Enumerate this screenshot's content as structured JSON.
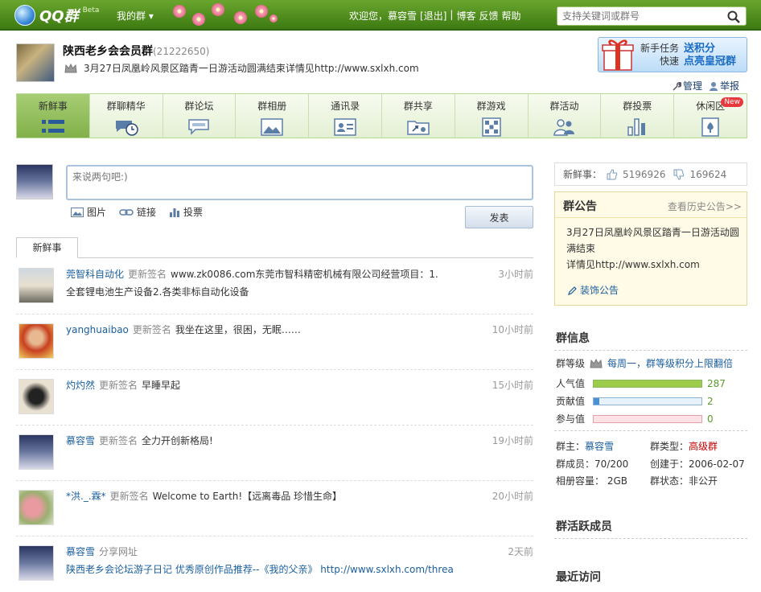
{
  "topbar": {
    "logo": "QQ群",
    "beta": "Beta",
    "my_group": "我的群 ▾",
    "welcome": "欢迎您，慕容雪",
    "logout": "[退出]",
    "sep": "|",
    "links": [
      "博客",
      "反馈",
      "帮助"
    ],
    "search_placeholder": "支持关键词或群号"
  },
  "group": {
    "name": "陕西老乡会会员群",
    "id": "(21222650)",
    "signature": "3月27日凤凰岭风景区踏青一日游活动圆满结束详情见http://www.sxlxh.com",
    "admin": "管理",
    "report": "举报"
  },
  "promo": {
    "line1a": "新手任务",
    "line1b": "送积分",
    "line2a": "快速",
    "line2b": "点亮皇冠群"
  },
  "tabs": [
    {
      "label": "新鲜事",
      "icon": "fresh-news-icon"
    },
    {
      "label": "群聊精华",
      "icon": "chat-digest-icon"
    },
    {
      "label": "群论坛",
      "icon": "forum-icon"
    },
    {
      "label": "群相册",
      "icon": "album-icon"
    },
    {
      "label": "通讯录",
      "icon": "contacts-icon"
    },
    {
      "label": "群共享",
      "icon": "share-folder-icon"
    },
    {
      "label": "群游戏",
      "icon": "game-icon"
    },
    {
      "label": "群活动",
      "icon": "activity-icon"
    },
    {
      "label": "群投票",
      "icon": "vote-icon"
    },
    {
      "label": "休闲区",
      "icon": "leisure-icon",
      "badge": "New"
    }
  ],
  "post": {
    "placeholder": "来说两句吧:)",
    "tool_image": "图片",
    "tool_link": "链接",
    "tool_vote": "投票",
    "submit": "发表"
  },
  "feed_tab": "新鲜事",
  "feed": [
    {
      "user": "莞智科自动化",
      "action": "更新签名",
      "text": "www.zk0086.com东莞市智科精密机械有限公司经营项目：1.",
      "line2": "全套锂电池生产设备2.各类非标自动化设备",
      "time": "3小时前"
    },
    {
      "user": "yanghuaibao",
      "action": "更新签名",
      "text": "我坐在这里，很困，无眠……",
      "line2": "",
      "time": "10小时前"
    },
    {
      "user": "灼灼然",
      "action": "更新签名",
      "text": "早睡早起",
      "line2": "",
      "time": "15小时前"
    },
    {
      "user": "慕容雪",
      "action": "更新签名",
      "text": "全力开创新格局!",
      "line2": "",
      "time": "19小时前"
    },
    {
      "user": "*洪._.霖*",
      "action": "更新签名",
      "text": "Welcome to Earth!【远离毒品 珍惜生命】",
      "line2": "",
      "time": "20小时前"
    },
    {
      "user": "慕容雪",
      "action": "分享网址",
      "text": "",
      "line2": "陕西老乡会论坛游子日记 优秀原创作品推荐--《我的父亲》  http://www.sxlxh.com/threa",
      "time": "2天前"
    }
  ],
  "stats": {
    "label": "新鲜事：",
    "likes": "5196926",
    "dislikes": "169624"
  },
  "notice": {
    "title": "群公告",
    "history": "查看历史公告>>",
    "body1": "3月27日凤凰岭风景区踏青一日游活动圆满结束",
    "body2": "详情见http://www.sxlxh.com",
    "edit": "装饰公告"
  },
  "info": {
    "title": "群信息",
    "level_label": "群等级",
    "level_link": "每周一，群等级积分上限翻倍",
    "popularity_label": "人气值",
    "popularity": "287",
    "popularity_fraction": 1.0,
    "contribution_label": "贡献值",
    "contribution": "2",
    "contribution_fraction": 0.05,
    "participation_label": "参与值",
    "participation": "0",
    "participation_fraction": 0,
    "owner_label": "群主：",
    "owner": "慕容雪",
    "type_label": "群类型：",
    "type": "高级群",
    "members": "群成员：70/200",
    "created": "创建于：2006-02-07",
    "album": "相册容量：  2GB",
    "status": "群状态：非公开"
  },
  "active_title": "群活跃成员",
  "recent_title": "最近访问",
  "colors": {
    "green": "#6aa62e",
    "link": "#1a5e9e",
    "promo_blue": "#1a6bc4",
    "red": "#c00000"
  }
}
